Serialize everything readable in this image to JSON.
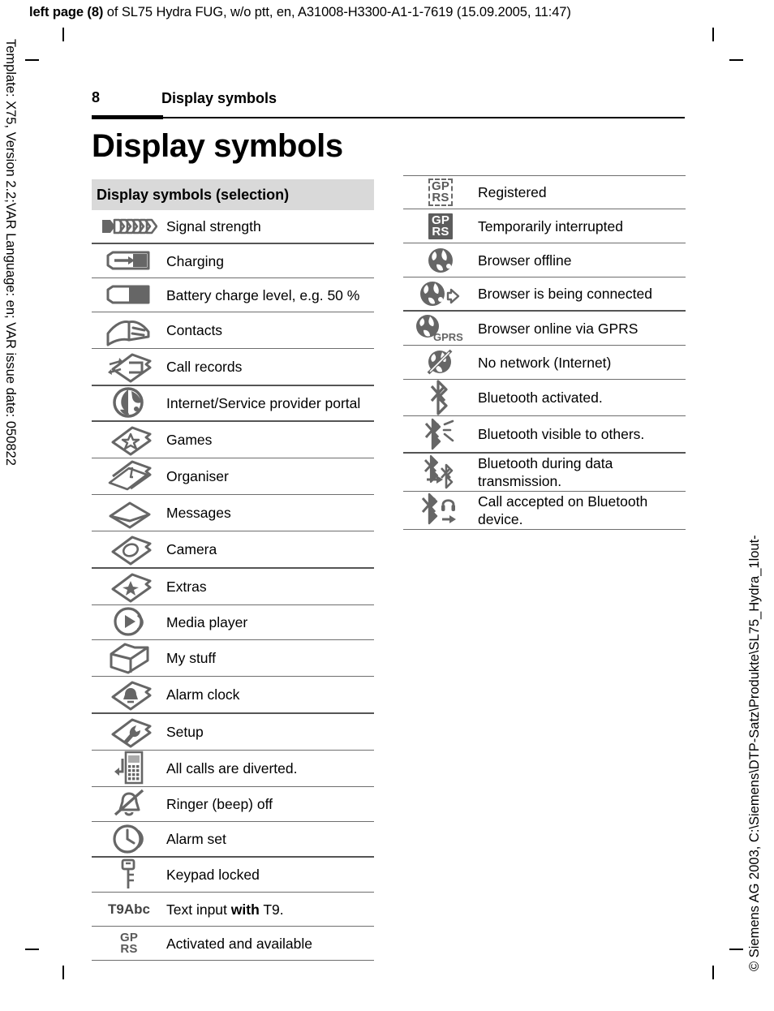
{
  "slug": {
    "bold_prefix": "left page (8)",
    "rest": " of SL75 Hydra FUG, w/o ptt, en, A31008-H3300-A1-1-7619 (15.09.2005, 11:47)"
  },
  "side_text": {
    "left": "Template: X75, Version 2.2;VAR Language: en; VAR issue date: 050822",
    "right": "© Siemens AG 2003, C:\\Siemens\\DTP-Satz\\Produkte\\SL75_Hydra_1lout-"
  },
  "header": {
    "page_number": "8",
    "running_head": "Display symbols",
    "title": "Display symbols"
  },
  "left_table": {
    "caption": "Display symbols (selection)",
    "rows": [
      {
        "icon": "signal-strength-icon",
        "label": "Signal strength",
        "sep": "strong"
      },
      {
        "icon": "charging-battery-icon",
        "label": "Charging",
        "sep": "normal"
      },
      {
        "icon": "battery-level-icon",
        "label": "Battery charge level, e.g. 50 %",
        "sep": "normal"
      },
      {
        "icon": "contacts-icon",
        "label": "Contacts",
        "sep": "normal"
      },
      {
        "icon": "call-records-icon",
        "label": "Call records",
        "sep": "strong"
      },
      {
        "icon": "internet-globe-icon",
        "label": "Internet/Service provider portal",
        "sep": "strong"
      },
      {
        "icon": "games-icon",
        "label": "Games",
        "sep": "normal"
      },
      {
        "icon": "organiser-icon",
        "label": "Organiser",
        "sep": "normal"
      },
      {
        "icon": "messages-icon",
        "label": "Messages",
        "sep": "normal"
      },
      {
        "icon": "camera-icon",
        "label": "Camera",
        "sep": "strong"
      },
      {
        "icon": "extras-star-icon",
        "label": "Extras",
        "sep": "normal"
      },
      {
        "icon": "media-player-icon",
        "label": "Media player",
        "sep": "normal"
      },
      {
        "icon": "my-stuff-folder-icon",
        "label": "My stuff",
        "sep": "normal"
      },
      {
        "icon": "alarm-clock-icon",
        "label": "Alarm clock",
        "sep": "strong"
      },
      {
        "icon": "setup-icon",
        "label": "Setup",
        "sep": "normal"
      },
      {
        "icon": "call-divert-icon",
        "label": "All calls are diverted.",
        "sep": "normal"
      },
      {
        "icon": "ringer-off-icon",
        "label": "Ringer (beep) off",
        "sep": "normal"
      },
      {
        "icon": "alarm-set-icon",
        "label": "Alarm set",
        "sep": "strong"
      },
      {
        "icon": "keypad-locked-icon",
        "label": "Keypad locked",
        "sep": "normal"
      },
      {
        "icon": "t9-text-input-icon",
        "label_prefix": "Text input ",
        "label_bold": "with",
        "label_suffix": " T9.",
        "sep": "normal"
      },
      {
        "icon": "gprs-available-icon",
        "label": "Activated and available",
        "sep": "normal"
      }
    ]
  },
  "right_table": {
    "rows": [
      {
        "icon": "gprs-registered-icon",
        "label": "Registered",
        "sep": "normal"
      },
      {
        "icon": "gprs-interrupted-icon",
        "label": "Temporarily interrupted",
        "sep": "normal"
      },
      {
        "icon": "browser-offline-icon",
        "label": "Browser offline",
        "sep": "normal"
      },
      {
        "icon": "browser-connecting-icon",
        "label": "Browser is being connected",
        "sep": "strong"
      },
      {
        "icon": "browser-online-gprs-icon",
        "label": "Browser online via GPRS",
        "sep": "normal"
      },
      {
        "icon": "no-network-icon",
        "label": "No network (Internet)",
        "sep": "normal"
      },
      {
        "icon": "bluetooth-active-icon",
        "label": "Bluetooth activated.",
        "sep": "normal"
      },
      {
        "icon": "bluetooth-visible-icon",
        "label": "Bluetooth visible to others.",
        "sep": "strong"
      },
      {
        "icon": "bluetooth-data-icon",
        "label": "Bluetooth during data transmission.",
        "sep": "normal"
      },
      {
        "icon": "bluetooth-call-icon",
        "label": "Call accepted on Bluetooth device.",
        "sep": "normal"
      }
    ],
    "icon_text": {
      "gprs_registered": {
        "l1": "GP",
        "l2": "RS"
      },
      "gprs_interrupted": {
        "l1": "GP",
        "l2": "RS"
      },
      "gprs_available": {
        "l1": "GP",
        "l2": "RS"
      },
      "browser_gprs": "GPRS",
      "t9": "T9Abc"
    }
  },
  "colors": {
    "icon_gray": "#666666",
    "caption_bg": "#d9d9d9",
    "rule": "#6e6e6e",
    "text": "#000000"
  }
}
